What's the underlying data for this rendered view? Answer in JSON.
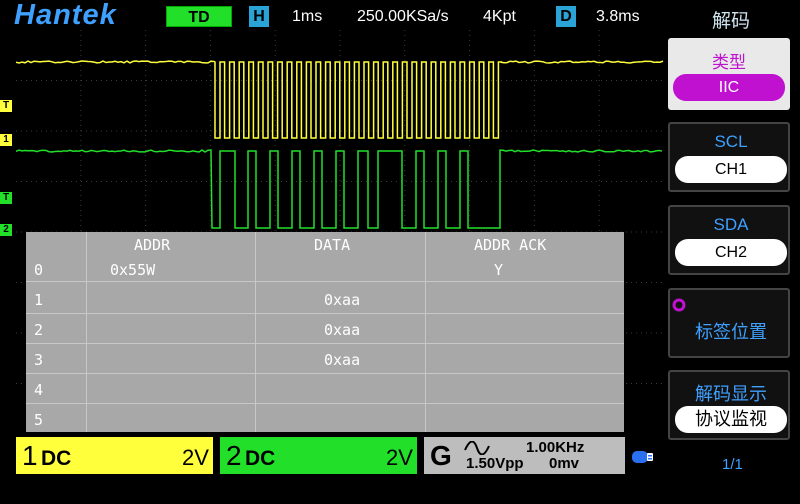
{
  "header": {
    "brand": "Hantek",
    "mode": "TD",
    "h_badge": "H",
    "timebase": "1ms",
    "sample_rate": "250.00KSa/s",
    "memory_depth": "4Kpt",
    "d_badge": "D",
    "trigger_delay": "3.8ms",
    "menu_title": "解码"
  },
  "channels": {
    "ch1": {
      "marker": "1",
      "trig_marker": "T",
      "color": "#ffff3c"
    },
    "ch2": {
      "marker": "2",
      "trig_marker": "T",
      "color": "#22e02a"
    }
  },
  "decode_table": {
    "headers": [
      "ADDR",
      "DATA",
      "ADDR ACK"
    ],
    "rows": [
      {
        "index": "0",
        "addr": "0x55W",
        "data": "",
        "ack": "Y"
      },
      {
        "index": "1",
        "addr": "",
        "data": "0xaa",
        "ack": ""
      },
      {
        "index": "2",
        "addr": "",
        "data": "0xaa",
        "ack": ""
      },
      {
        "index": "3",
        "addr": "",
        "data": "0xaa",
        "ack": ""
      },
      {
        "index": "4",
        "addr": "",
        "data": "",
        "ack": ""
      },
      {
        "index": "5",
        "addr": "",
        "data": "",
        "ack": ""
      }
    ]
  },
  "menu": {
    "type_label": "类型",
    "type_value": "IIC",
    "scl_label": "SCL",
    "scl_value": "CH1",
    "sda_label": "SDA",
    "sda_value": "CH2",
    "label_position": "标签位置",
    "decode_display_label": "解码显示",
    "decode_display_value": "协议监视",
    "accent": "#c010d0"
  },
  "status": {
    "ch1_num": "1",
    "ch1_coupling": "DC",
    "ch1_volts": "2V",
    "ch2_num": "2",
    "ch2_coupling": "DC",
    "ch2_volts": "2V",
    "gen_letter": "G",
    "gen_freq": "1.00KHz",
    "gen_amp": "1.50Vpp",
    "gen_offset": "0mv",
    "page": "1/1"
  }
}
